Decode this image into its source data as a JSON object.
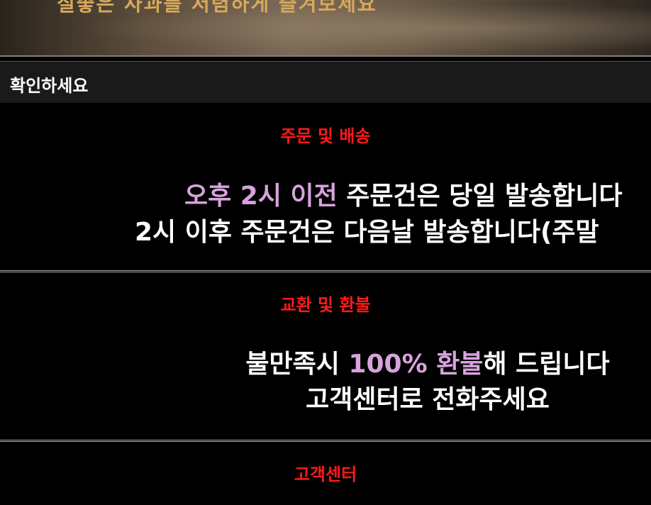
{
  "banner": {
    "text": "질좋은 사과를 저렴하게 즐겨보세요"
  },
  "confirm": {
    "title": "확인하세요"
  },
  "shipping": {
    "title": "주문 및 배송",
    "line1_highlight": "오후 2시 이전",
    "line1_rest": " 주문건은 당일 발송합니다",
    "line2": "2시 이후 주문건은 다음날 발송합니다(주말"
  },
  "refund": {
    "title": "교환 및 환불",
    "line1_pre": "불만족시 ",
    "line1_highlight": "100% 환불",
    "line1_post": "해 드립니다",
    "line2": "고객센터로 전화주세요"
  },
  "support": {
    "title": "고객센터"
  },
  "colors": {
    "section_title": "#ff1a1a",
    "highlight": "#d7a3dd",
    "banner_text": "#d7a95a"
  }
}
